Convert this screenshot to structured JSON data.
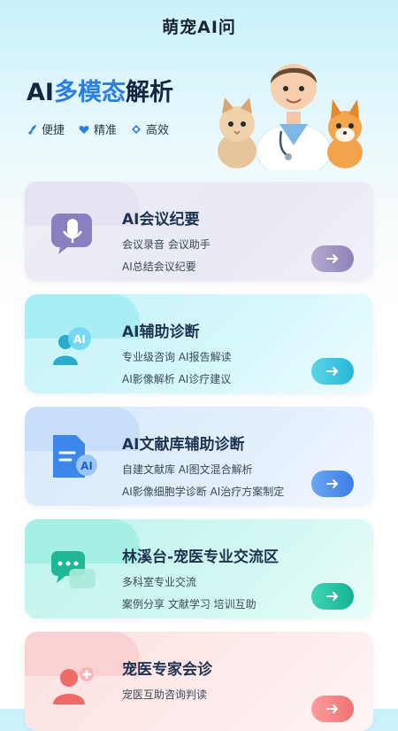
{
  "header": {
    "title": "萌宠AI问"
  },
  "hero": {
    "title_plain": "AI",
    "title_highlight": "多模态",
    "title_rest": "解析",
    "features": [
      {
        "icon": "rocket-icon",
        "label": "便捷"
      },
      {
        "icon": "heart-shield-icon",
        "label": "精准"
      },
      {
        "icon": "target-icon",
        "label": "高效"
      }
    ]
  },
  "cards": [
    {
      "title": "AI会议纪要",
      "line1": "会议录音 会议助手",
      "line2": "AI总结会议纪要",
      "icon": "microphone-icon"
    },
    {
      "title": "AI辅助诊断",
      "line1": "专业级咨询 AI报告解读",
      "line2": "AI影像解析 AI诊疗建议",
      "icon": "ai-doctor-icon"
    },
    {
      "title": "AI文献库辅助诊断",
      "line1": "自建文献库 AI图文混合解析",
      "line2": "AI影像细胞学诊断 AI治疗方案制定",
      "icon": "document-ai-icon"
    },
    {
      "title": "林溪台-宠医专业交流区",
      "line1": "多科室专业交流",
      "line2": "案例分享 文献学习 培训互助",
      "icon": "chat-bubbles-icon"
    },
    {
      "title": "宠医专家会诊",
      "line1": "宠医互助咨询判读",
      "line2": "",
      "icon": "expert-consult-icon"
    }
  ],
  "colors": {
    "accent": "#2a7fe0",
    "card1": "#8f82b8",
    "card2": "#26b6d6",
    "card3": "#3b7fe6",
    "card4": "#15b395",
    "card5": "#f07272"
  }
}
